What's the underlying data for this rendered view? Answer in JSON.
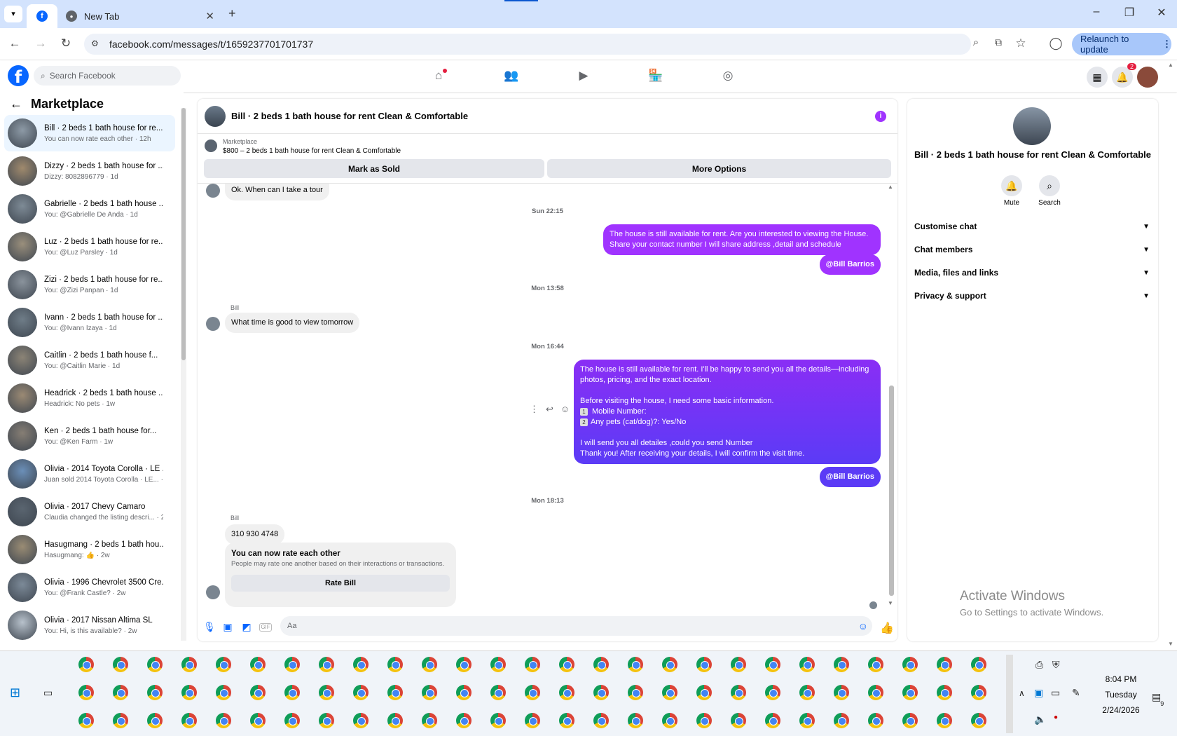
{
  "browser": {
    "tabs": [
      {
        "label": "",
        "favicon": "facebook-icon",
        "active": true
      },
      {
        "label": "New Tab",
        "favicon": "chrome-icon",
        "active": false
      }
    ],
    "url": "facebook.com/messages/t/1659237701701737",
    "relaunch_label": "Relaunch to update"
  },
  "fb": {
    "logo": "f",
    "search_placeholder": "Search Facebook",
    "notification_count": "2"
  },
  "sidebar": {
    "title": "Marketplace",
    "conversations": [
      {
        "name": "Bill · 2 beds 1 bath house for re...",
        "sub": "You can now rate each other · 12h",
        "selected": true
      },
      {
        "name": "Dizzy · 2 beds 1 bath house for ...",
        "sub": "Dizzy: 8082896779 · 1d"
      },
      {
        "name": "Gabrielle · 2 beds 1 bath house ...",
        "sub": "You: @Gabrielle De Anda · 1d"
      },
      {
        "name": "Luz · 2 beds 1 bath house for re...",
        "sub": "You: @Luz Parsley · 1d"
      },
      {
        "name": "Zizi · 2 beds 1 bath house for re...",
        "sub": "You: @Zizi Panpan · 1d"
      },
      {
        "name": "Ivann · 2 beds 1 bath house for ...",
        "sub": "You: @Ivann Izaya · 1d"
      },
      {
        "name": "Caitlin · 2 beds 1 bath house f...",
        "sub": "You: @Caitlin Marie · 1d"
      },
      {
        "name": "Headrick · 2 beds 1 bath house ...",
        "sub": "Headrick: No pets · 1w"
      },
      {
        "name": "Ken · 2 beds 1 bath house for...",
        "sub": "You: @Ken Farm · 1w"
      },
      {
        "name": "Olivia · 2014 Toyota Corolla · LE ...",
        "sub": "Juan sold 2014 Toyota Corolla · LE... · 1w"
      },
      {
        "name": "Olivia · 2017 Chevy Camaro",
        "sub": "Claudia changed the listing descri... · 2w"
      },
      {
        "name": "Hasugmang · 2 beds 1 bath hou...",
        "sub": "Hasugmang: 👍 · 2w"
      },
      {
        "name": "Olivia · 1996 Chevrolet 3500 Cre...",
        "sub": "You: @Frank Castle? · 2w"
      },
      {
        "name": "Olivia · 2017 Nissan Altima SL",
        "sub": "You: Hi, is this available? · 2w"
      }
    ]
  },
  "chat": {
    "title": "Bill · 2 beds 1 bath house for rent Clean & Comfortable",
    "marketplace_label": "Marketplace",
    "listing": "$800 – 2 beds 1 bath house for rent Clean & Comfortable",
    "mark_sold": "Mark as Sold",
    "more_options": "More Options",
    "messages": {
      "m0": "Ok. When can I take a tour",
      "ts1": "Sun 22:15",
      "m1a": "The house is still available for rent. Are you interested to viewing  the House.",
      "m1b": "Share your contact number I will share address ,detail and schedule",
      "mention1": "@Bill Barrios",
      "ts2": "Mon 13:58",
      "sender2": "Bill",
      "m2": "What time is good to view tomorrow",
      "ts3": "Mon 16:44",
      "m3_l1": "The house is still available for rent. I'll be happy to send you all the details—including",
      "m3_l2": "photos, pricing, and the exact location.",
      "m3_l3": "Before visiting the house, I need some basic information.",
      "m3_l4": "Mobile Number:",
      "m3_l5": "Any pets (cat/dog)?: Yes/No",
      "m3_l6": "I will send you all detailes ,could you send Number",
      "m3_l7": "Thank you! After receiving your details, I will confirm the visit time.",
      "mention2": "@Bill Barrios",
      "ts4": "Mon 18:13",
      "sender4": "Bill",
      "m4": "310 930 4748",
      "rate_title": "You can now rate each other",
      "rate_sub": "People may rate one another based on their interactions or transactions.",
      "rate_btn": "Rate Bill"
    },
    "composer_placeholder": "Aa"
  },
  "details": {
    "title": "Bill · 2 beds 1 bath house for rent Clean & Comfortable",
    "mute": "Mute",
    "search": "Search",
    "rows": [
      "Customise chat",
      "Chat members",
      "Media, files and links",
      "Privacy & support"
    ]
  },
  "watermark": {
    "line1": "Activate Windows",
    "line2": "Go to Settings to activate Windows."
  },
  "taskbar": {
    "time": "8:04 PM",
    "day": "Tuesday",
    "date": "2/24/2026",
    "notif": "9"
  },
  "colors": {
    "fb_blue": "#0866ff",
    "purple": "#a033ff",
    "bubble_gradient_end": "#5b3bf6"
  }
}
